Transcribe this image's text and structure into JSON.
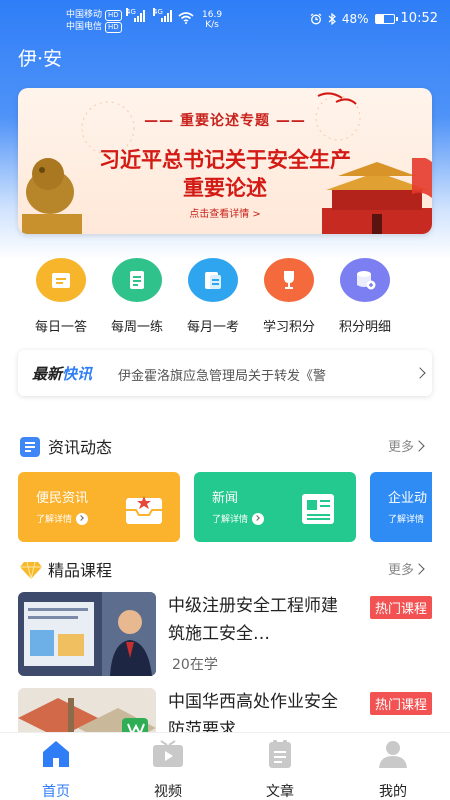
{
  "status_bar": {
    "carrier1": "中国移动",
    "carrier2": "中国电信",
    "hd": "HD",
    "net1": "4G",
    "net2": "4G",
    "speed_value": "16.9",
    "speed_unit": "K/s",
    "battery_text": "48%",
    "battery_level": 0.48,
    "time": "10:52"
  },
  "app": {
    "title": "伊·安"
  },
  "banner": {
    "subtitle": "—— 重要论述专题 ——",
    "title_line1": "习近平总书记关于安全生产",
    "title_line2": "重要论述",
    "link": "点击查看详情 >"
  },
  "quick_actions": [
    {
      "label": "每日一答",
      "icon": "note-icon",
      "color": "#f7b52c"
    },
    {
      "label": "每周一练",
      "icon": "document-icon",
      "color": "#2fc28a"
    },
    {
      "label": "每月一考",
      "icon": "clipboard-icon",
      "color": "#2fa5f0"
    },
    {
      "label": "学习积分",
      "icon": "trophy-icon",
      "color": "#f56a3d"
    },
    {
      "label": "积分明细",
      "icon": "database-icon",
      "color": "#7b7ff2"
    }
  ],
  "ticker": {
    "tag_prefix": "最新",
    "tag_suffix": "快讯",
    "text": "伊金霍洛旗应急管理局关于转发《警"
  },
  "news_section": {
    "title": "资讯动态",
    "more": "更多",
    "cards": [
      {
        "title": "便民资讯",
        "detail": "了解详情",
        "color": "#fbb22c"
      },
      {
        "title": "新闻",
        "detail": "了解详情",
        "color": "#23c98e"
      },
      {
        "title": "企业动",
        "detail": "了解详情",
        "color": "#2f8cf5"
      }
    ]
  },
  "course_section": {
    "title": "精品课程",
    "more": "更多",
    "courses": [
      {
        "title": "中级注册安全工程师建筑施工安全…",
        "badge": "热门课程",
        "count": "20在学"
      },
      {
        "title": "中国华西高处作业安全防范要求",
        "badge": "热门课程",
        "count": ""
      }
    ]
  },
  "bottom_nav": [
    {
      "label": "首页",
      "icon": "home-icon",
      "active": true
    },
    {
      "label": "视频",
      "icon": "video-icon",
      "active": false
    },
    {
      "label": "文章",
      "icon": "article-icon",
      "active": false
    },
    {
      "label": "我的",
      "icon": "profile-icon",
      "active": false
    }
  ],
  "colors": {
    "primary": "#2f7ef7",
    "badge_red": "#f25252",
    "banner_red": "#d31a14"
  }
}
